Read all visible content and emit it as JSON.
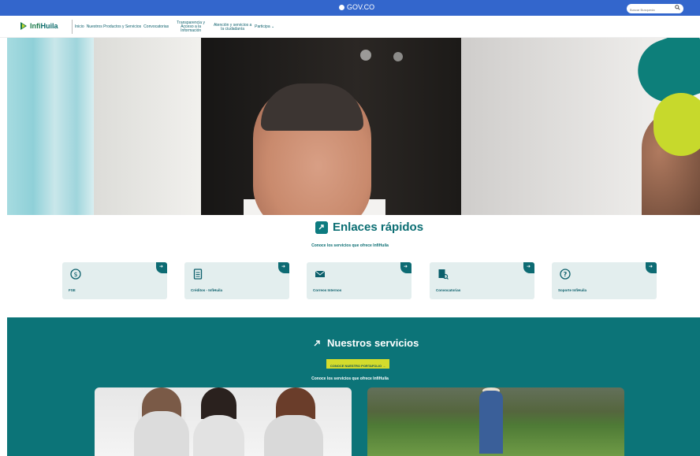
{
  "gov_bar": {
    "label": "GOV.CO",
    "search_placeholder": "Buscar Busqueda"
  },
  "brand": {
    "prefix": "Infi",
    "name": "Huila"
  },
  "nav": {
    "items": [
      {
        "label": "Inicio"
      },
      {
        "label": "Nuestros Productos y Servicios"
      },
      {
        "label": "Convocatorias"
      },
      {
        "label": "Transparencia y Acceso a la Información"
      },
      {
        "label": "Atención y servicios a la ciudadanía"
      },
      {
        "label": "Participa"
      }
    ],
    "participa_chevron": "⌄"
  },
  "quick_links": {
    "title": "Enlaces rápidos",
    "subtitle": "Conoce los servicios que ofrece InfiHuila",
    "cards": [
      {
        "label": "FSE",
        "icon": "dollar-circle-icon"
      },
      {
        "label": "Créditos - InfiHuila",
        "icon": "document-icon"
      },
      {
        "label": "Correos Internos",
        "icon": "envelope-icon"
      },
      {
        "label": "Convocatorias",
        "icon": "document-search-icon"
      },
      {
        "label": "Soporte InfiHuila",
        "icon": "question-circle-icon"
      }
    ]
  },
  "services": {
    "title": "Nuestros servicios",
    "button": "CONOCE NUESTRO PORTAFOLIO →",
    "subtitle": "Conoce los servicios que ofrece InfiHuila"
  },
  "colors": {
    "gov_blue": "#3366cc",
    "teal": "#0c7478",
    "lime": "#d4dc2c",
    "card_bg": "#e3eeee"
  }
}
